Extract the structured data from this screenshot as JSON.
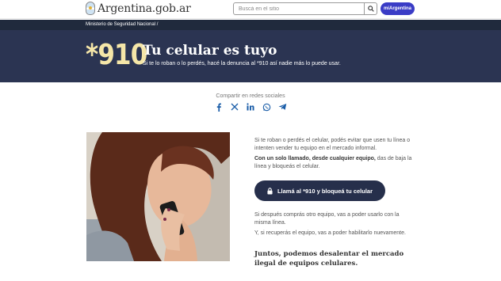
{
  "header": {
    "logo_text": "Argentina.gob.ar",
    "search_placeholder": "Buscá en el sitio",
    "mi_argentina_label": "miArgentina"
  },
  "breadcrumb": "Ministerio de Seguridad Nacional /",
  "hero": {
    "number": "*910",
    "title": "Tu celular es tuyo",
    "subtitle": "Si te lo roban o lo perdés, hacé la denuncia al *910 así nadie más lo puede usar."
  },
  "share": {
    "label": "Compartir en redes sociales",
    "icons": [
      "facebook-icon",
      "x-icon",
      "linkedin-icon",
      "whatsapp-icon",
      "telegram-icon"
    ]
  },
  "content": {
    "p1": "Si te roban o perdés el celular, podés evitar que usen tu línea o intenten vender tu equipo en el mercado informal.",
    "p2_bold": "Con un solo llamado, desde cualquier equipo,",
    "p2_rest": " das de baja la línea y bloqueás el celular.",
    "cta_label": "Llamá al *910 y bloqueá tu celular",
    "p3": "Si después comprás otro equipo, vas a poder usarlo con la misma línea.",
    "p4": "Y, si recuperás el equipo, vas a poder habilitarlo nuevamente.",
    "closing": "Juntos, podemos desalentar el mercado ilegal de equipos celulares."
  },
  "colors": {
    "hero_bg": "#2b3452",
    "crumb_bg": "#202a3d",
    "hero_number": "#f5e6a8",
    "cta_bg": "#262f4b",
    "brand_button": "#3a3cc6",
    "share_icon": "#1a5da8"
  }
}
